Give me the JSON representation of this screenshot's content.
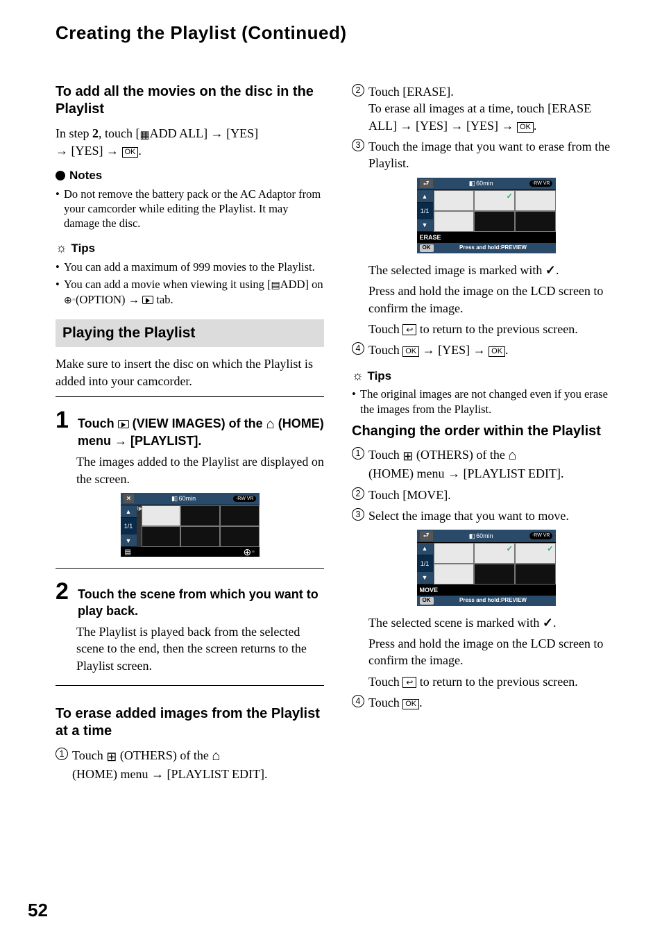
{
  "header": "Creating the Playlist (Continued)",
  "pageNumber": "52",
  "left": {
    "h_addAll": "To add all the movies on the disc in the Playlist",
    "addAll_body_pre": "In step ",
    "addAll_body_bold": "2",
    "addAll_body_post": ", touch [",
    "addAll_body_label": "ADD ALL]  ",
    "yes1": " [YES] ",
    "yes2": " [YES] ",
    "notes_label": "Notes",
    "note1": "Do not remove the battery pack or the AC Adaptor from your camcorder while editing the Playlist. It may damage the disc.",
    "tips_label": "Tips",
    "tip1": "You can add a maximum of 999 movies to the Playlist.",
    "tip2_a": "You can add a movie when viewing it using [",
    "tip2_b": "ADD] on ",
    "tip2_c": "(OPTION) ",
    "tip2_d": " tab.",
    "play_header": "Playing the Playlist",
    "play_intro": "Make sure to insert the disc on which the Playlist is added into your camcorder.",
    "step1_num": "1",
    "step1_a": "Touch ",
    "step1_b": " (VIEW IMAGES) of the ",
    "step1_c": " (HOME) menu ",
    "step1_d": " [PLAYLIST].",
    "step1_body": "The images added to the Playlist are displayed on the screen.",
    "step2_num": "2",
    "step2_title": "Touch the scene from which you want to play back.",
    "step2_body": "The Playlist is played back from the selected scene to the end, then the screen returns to the Playlist screen.",
    "h_erase": "To erase added images from the Playlist at a time",
    "erase1_a": "Touch ",
    "erase1_b": " (OTHERS) of the ",
    "erase1_c": "(HOME) menu ",
    "erase1_d": " [PLAYLIST EDIT]."
  },
  "right": {
    "r2_a": "Touch [ERASE].",
    "r2_b": "To erase all images at a time, touch [ERASE ALL] ",
    "r2_c": " [YES] ",
    "r2_d": " [YES] ",
    "r3": "Touch the image that you want to erase from the Playlist.",
    "sel_marked": "The selected image is marked with ",
    "press_hold": "Press and hold the image on the LCD screen to confirm the image.",
    "touch_return_a": "Touch ",
    "touch_return_b": " to return to the previous screen.",
    "r4_a": "Touch ",
    "r4_b": " [YES] ",
    "tips_label": "Tips",
    "tip_r": "The original images are not changed even if you erase the images from the Playlist.",
    "h_change": "Changing the order within the Playlist",
    "c1_a": "Touch ",
    "c1_b": " (OTHERS) of the ",
    "c1_c": "(HOME) menu ",
    "c1_d": " [PLAYLIST EDIT].",
    "c2": "Touch [MOVE].",
    "c3": "Select the image that you want to move.",
    "sel_scene": "The selected scene is marked with ",
    "c4": "Touch "
  },
  "thumb": {
    "time": "60min",
    "rw": "-RW VR",
    "page": "1/1",
    "erase": "ERASE",
    "move": "MOVE",
    "ok": "OK",
    "preview": "Press and hold:PREVIEW"
  },
  "sym": {
    "ok": "OK",
    "arrow": "→",
    "ret": "↩",
    "dot": "."
  }
}
